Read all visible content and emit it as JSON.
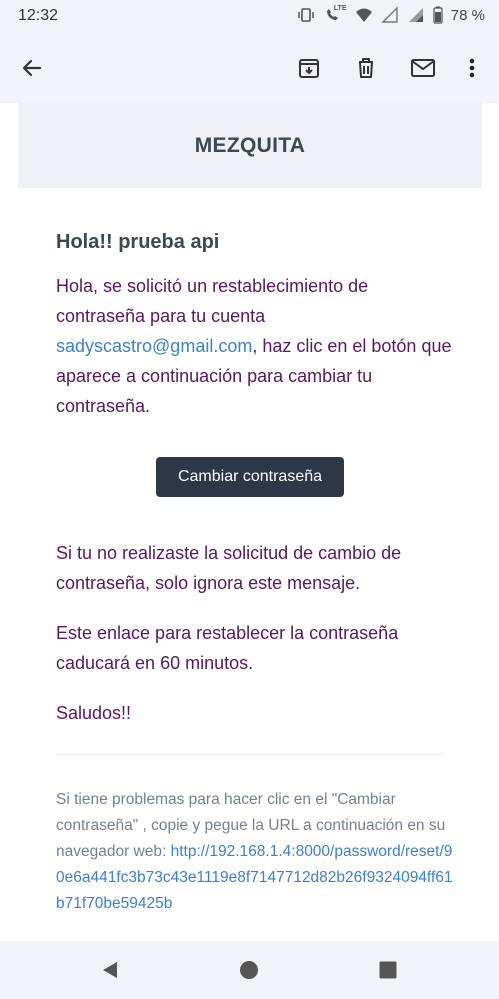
{
  "status_bar": {
    "time": "12:32",
    "battery": "78 %",
    "network_label": "LTE",
    "icons": [
      "vibrate-icon",
      "lte-call-icon",
      "wifi-icon",
      "signal-icon",
      "battery-icon"
    ]
  },
  "app_bar": {
    "icons": [
      "back-arrow-icon",
      "archive-icon",
      "delete-icon",
      "mark-unread-icon",
      "more-vert-icon"
    ]
  },
  "email": {
    "brand": "MEZQUITA",
    "greeting": "Hola!! prueba api",
    "intro_before": "Hola, se solicitó un restablecimiento de contraseña para tu cuenta ",
    "intro_email": "sadyscastro@gmail.com",
    "intro_after": ", haz clic en el botón que aparece a continuación para cambiar tu contraseña.",
    "button_label": "Cambiar contraseña",
    "ignore_text": "Si tu no realizaste la solicitud de cambio de contraseña, solo ignora este mensaje.",
    "expiry_text": "Este enlace para restablecer la contraseña caducará en 60 minutos.",
    "signoff": "Saludos!!",
    "footer_text": "Si tiene problemas para hacer clic en el \"Cambiar contraseña\" , copie y pegue la URL a continuación en su navegador web: ",
    "reset_url": "http://192.168.1.4:8000/password/reset/90e6a441fc3b73c43e1119e8f7147712d82b26f9324094ff61b71f70be59425b"
  },
  "colors": {
    "accent_link": "#3a7fd6",
    "body_text": "#5a1762",
    "heading": "#3d4852",
    "button_bg": "#2d3748"
  },
  "nav_bar": {
    "icons": [
      "back-triangle-icon",
      "home-circle-icon",
      "recents-square-icon"
    ]
  }
}
